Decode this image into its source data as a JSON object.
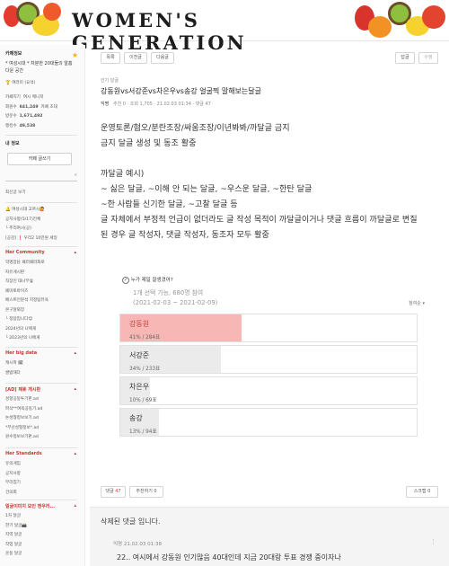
{
  "banner": {
    "title": "WOMEN'S GENERATION"
  },
  "sidebar": {
    "cafe_info": "카페정보",
    "cafe_name": "* 여성시대 * 차분한 20대들의 알흠다운 공간",
    "level": "여러미 (요석)",
    "stats": [
      {
        "label": "카페지기",
        "value": "여시 매니저"
      },
      {
        "label": "회원수",
        "value": "841,249",
        "extra": "카페 초대"
      },
      {
        "label": "방문수",
        "value": "1,671,492"
      },
      {
        "label": "랭킹수",
        "value": "49,538"
      }
    ],
    "my_activity": "내 정보",
    "write_button": "카페 글쓰기",
    "search_label": "최신글 보기",
    "menu_top": [
      "🔔 여성시대 고르시🙋",
      "공지사항(5/17)전체",
      "└ 추리여시(공)",
      "[공감] ❗ 우리2 10만원 세일"
    ],
    "community_title": "Her Community",
    "community_items": [
      "익명잡담 패러패러화로",
      "자유게시판",
      "직장인 대나무숲",
      "페미토마이즈",
      "베스트인분석 지정탐뷰욕",
      "온구달뫼장",
      "└ 정답입니다😊",
      "2024년의 나에게",
      "└ 2023년의 나에게"
    ],
    "bigdata_title": "Her big data",
    "bigdata_items": [
      "캐시파 🗓",
      "쌀밥해다"
    ],
    "ad_title": "[AD] 제휴 게시판",
    "ad_items": [
      "성향공동투기판.ad",
      "파삭**여욕공동기.ad",
      "논성형정보보기.ad",
      "*부산성형정보*.ad",
      "원수정보보기판.ad"
    ],
    "standards_title": "Her Standards",
    "standards_items": [
      "유의게임",
      "공지사항",
      "부리칩기",
      "건의회"
    ],
    "extra_title": "얼굴이미지 모인 앤우리...",
    "extra_items": [
      "1차 달글",
      "한기 달글📸",
      "지역 달글",
      "작업 달글",
      "운동 달글",
      "관광정보 달글"
    ]
  },
  "toolbar": {
    "buttons": [
      "목록",
      "이전글",
      "다음글"
    ],
    "right_buttons": [
      "답글",
      "수정"
    ]
  },
  "post": {
    "category": "인기 달글",
    "title": "강동원vs서강준vs차은우vs송강 얼굴찍 말해보는달글",
    "author": "익명",
    "meta": "추천 0 · 조회 1,705 · 21.02.03 01:34 · 댓글 47",
    "body": [
      "운영토론/혐오/분란조장/싸움조장/이년봐봐/까달글 금지",
      "금지 달글 생성 및 동조 활중",
      "",
      "까달글 예시)",
      "~ 싫은 달글, ~이해 안 되는 달글, ~우스운 달글, ~한탄 달글",
      "~한 사람들 신기한 달글, ~고찰 달글 등",
      "글 자체에서 부정적 언급이 없더라도 글 작성 목적이 까달글이거나 댓글 흐름이 까달글로 변질",
      "된 경우 글 작성자, 댓글 작성자, 동조자 모두 활중"
    ]
  },
  "vote": {
    "question": "누가 제일 잘생겼어?",
    "info": "1개 선택 가능, 680명 참여",
    "period": "(2021-02-03 ~ 2021-02-09)",
    "order": "참여순 ▾",
    "options": [
      {
        "name": "강동원",
        "percent": 41,
        "label": "41% / 284표"
      },
      {
        "name": "서강준",
        "percent": 34,
        "label": "34% / 233표"
      },
      {
        "name": "차은우",
        "percent": 10,
        "label": "10% / 69표"
      },
      {
        "name": "송강",
        "percent": 13,
        "label": "13% / 94표"
      }
    ]
  },
  "actions": {
    "comment_label": "댓글",
    "comment_count": "47",
    "recommend": "추천하기 0",
    "scrap": "스크랩 0"
  },
  "comments": {
    "deleted": "삭제된 댓글 입니다.",
    "first_meta": "익명 21.02.03 01:38",
    "first_text": "22.. 여시에서 강동원 인기많음 40대인데 지금 20대랑 투표 경쟁 중이자나"
  }
}
